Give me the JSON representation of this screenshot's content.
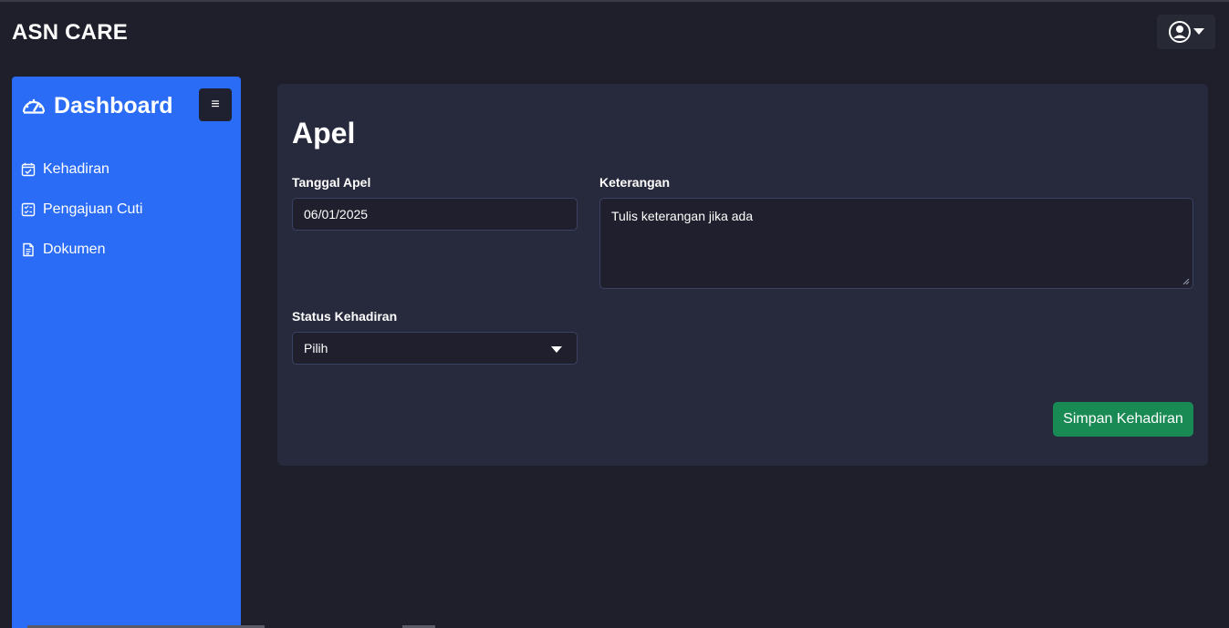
{
  "app": {
    "brand": "ASN CARE"
  },
  "header": {
    "user_icon": "user-circle-icon",
    "dropdown_icon": "caret-down-icon"
  },
  "sidebar": {
    "title": "Dashboard",
    "title_icon": "speedometer-icon",
    "toggle_label": "≡",
    "accent_color": "#2a6cf6",
    "items": [
      {
        "label": "Kehadiran",
        "icon": "calendar-check-icon"
      },
      {
        "label": "Pengajuan Cuti",
        "icon": "checklist-icon"
      },
      {
        "label": "Dokumen",
        "icon": "document-icon"
      }
    ]
  },
  "main": {
    "title": "Apel",
    "date_label": "Tanggal Apel",
    "date_value": "06/01/2025",
    "notes_label": "Keterangan",
    "notes_placeholder": "Tulis keterangan jika ada",
    "status_label": "Status Kehadiran",
    "status_selected": "Pilih",
    "submit_label": "Simpan Kehadiran",
    "submit_color": "#1a8a55"
  }
}
